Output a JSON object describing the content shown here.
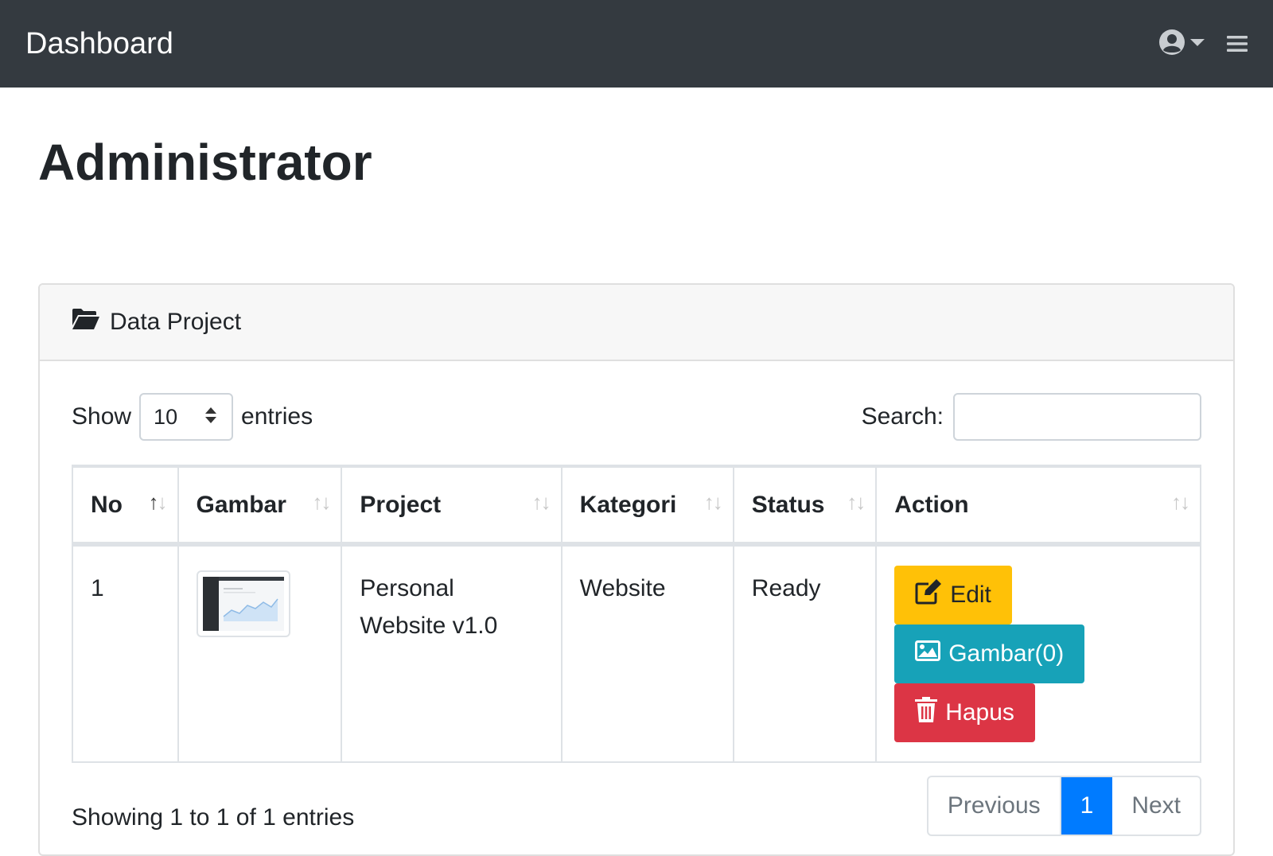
{
  "navbar": {
    "brand": "Dashboard",
    "user_icon": "user-circle-icon",
    "menu_icon": "hamburger-icon"
  },
  "page": {
    "title": "Administrator"
  },
  "card": {
    "header_icon": "folder-open-icon",
    "header_title": "Data Project"
  },
  "controls": {
    "show_label": "Show",
    "length_value": "10",
    "entries_label": "entries",
    "search_label": "Search:",
    "search_value": ""
  },
  "table": {
    "columns": [
      "No",
      "Gambar",
      "Project",
      "Kategori",
      "Status",
      "Action"
    ],
    "rows": [
      {
        "no": "1",
        "project": "Personal Website v1.0",
        "kategori": "Website",
        "status": "Ready",
        "actions": {
          "edit": "Edit",
          "gambar": "Gambar(0)",
          "hapus": "Hapus"
        }
      }
    ]
  },
  "footer": {
    "info": "Showing 1 to 1 of 1 entries",
    "previous": "Previous",
    "current_page": "1",
    "next": "Next"
  },
  "colors": {
    "navbar": "#343a40",
    "edit": "#ffc107",
    "gambar": "#17a2b8",
    "hapus": "#dc3545",
    "active_page": "#007bff"
  }
}
